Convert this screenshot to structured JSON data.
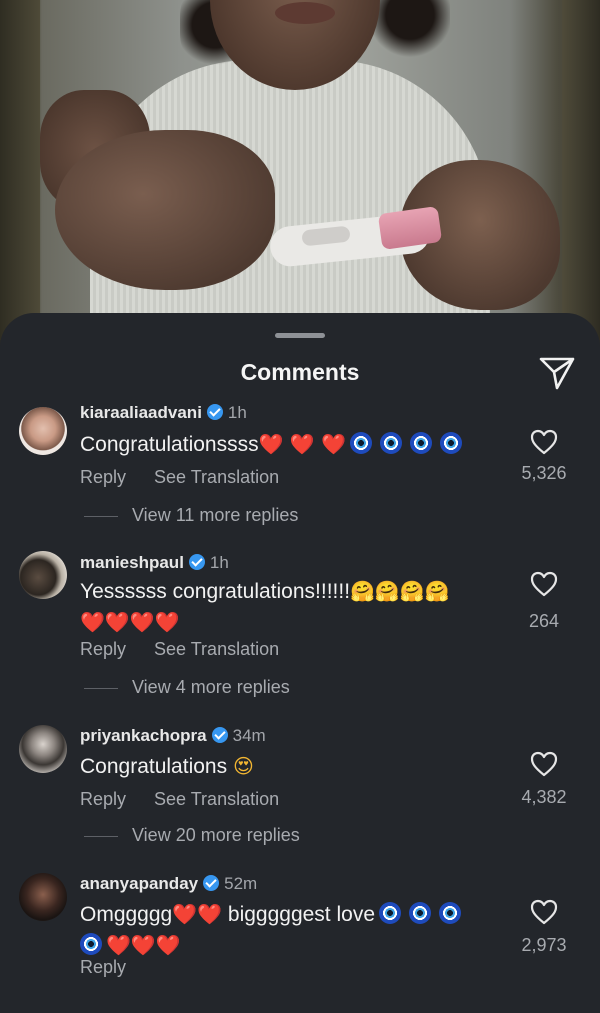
{
  "sheet": {
    "title": "Comments"
  },
  "comments": [
    {
      "username": "kiaraaliaadvani",
      "time": "1h",
      "text": "Congratulationssss",
      "emoji_line": "❤️ ❤️ ❤️",
      "actions": {
        "reply": "Reply",
        "translate": "See Translation"
      },
      "likes": "5,326",
      "view_more": "View 11 more replies"
    },
    {
      "username": "manieshpaul",
      "time": "1h",
      "text": "Yessssss congratulations!!!!!!",
      "emoji_line": "🤗🤗🤗🤗",
      "emoji_line2": "❤️❤️❤️❤️",
      "actions": {
        "reply": "Reply",
        "translate": "See Translation"
      },
      "likes": "264",
      "view_more": "View 4 more replies"
    },
    {
      "username": "priyankachopra",
      "time": "34m",
      "text": "Congratulations",
      "emoji_line": "😍",
      "actions": {
        "reply": "Reply",
        "translate": "See Translation"
      },
      "likes": "4,382",
      "view_more": "View 20 more replies"
    },
    {
      "username": "ananyapanday",
      "time": "52m",
      "text": "Omggggg",
      "emoji_line": "❤️❤️",
      "text2": "bigggggest love",
      "emoji_line2": "❤️❤️❤️",
      "actions": {
        "reply": "Reply"
      },
      "likes": "2,973"
    }
  ],
  "icons": {
    "share": "paper-plane-icon",
    "like": "heart-outline-icon",
    "verified": "verified-badge-icon"
  },
  "colors": {
    "sheet_bg": "#23262b",
    "verified": "#3797f0",
    "heart": "#e8262c"
  }
}
